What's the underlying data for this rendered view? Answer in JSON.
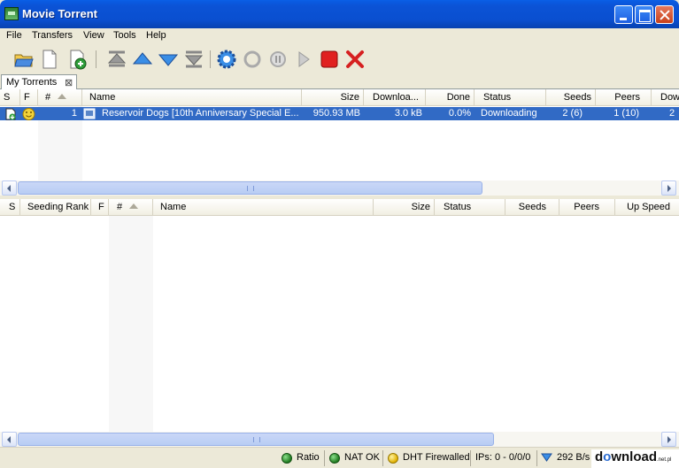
{
  "window": {
    "title": "Movie Torrent"
  },
  "menu": [
    "File",
    "Transfers",
    "View",
    "Tools",
    "Help"
  ],
  "tabs": [
    {
      "label": "My Torrents"
    }
  ],
  "top_table": {
    "columns": [
      "S",
      "F",
      "#",
      "Name",
      "Size",
      "Downloa...",
      "Done",
      "Status",
      "Seeds",
      "Peers",
      "Dow"
    ],
    "rows": [
      {
        "rank": "1",
        "name": "Reservoir Dogs [10th Anniversary Special E...",
        "size": "950.93 MB",
        "downloaded": "3.0 kB",
        "done": "0.0%",
        "status": "Downloading",
        "seeds": "2 (6)",
        "peers": "1 (10)",
        "down": "2"
      }
    ]
  },
  "bottom_table": {
    "columns": [
      "S",
      "Seeding Rank",
      "F",
      "#",
      "Name",
      "Size",
      "Status",
      "Seeds",
      "Peers",
      "Up Speed"
    ]
  },
  "statusbar": {
    "ratio": "Ratio",
    "nat": "NAT OK",
    "dht": "DHT Firewalled",
    "ips": "IPs: 0 - 0/0/0",
    "speed": "292 B/s"
  },
  "watermark": {
    "pre": "d",
    "o": "o",
    "post": "wnload",
    "suffix": ".net.pl"
  },
  "colors": {
    "selection": "#316ac5",
    "titlebar": "#0a4fd0",
    "ok": "#1f7a1f",
    "warn": "#e0b000"
  }
}
